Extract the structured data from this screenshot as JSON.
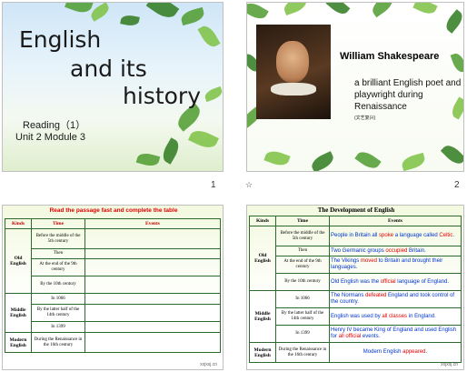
{
  "slides": [
    {
      "number": "1",
      "title_lines": [
        "English",
        "and its",
        "history"
      ],
      "reading": "Reading（1）",
      "unit": "Unit 2 Module 3"
    },
    {
      "number": "2",
      "name": "William Shakespeare",
      "description": "a brilliant English poet and playwright during Renaissance",
      "note": "(文艺复兴)"
    },
    {
      "number": "",
      "heading": "Read the passage fast and complete the table"
    },
    {
      "number": "",
      "heading": "The Development of English"
    }
  ],
  "table": {
    "headers": [
      "Kinds",
      "Time",
      "Events"
    ],
    "kinds": [
      "Old English",
      "Middle English",
      "Modern English"
    ],
    "times": [
      "Before the middle of the 5th century",
      "Then",
      "At the end of the 9th century",
      "By the 10th century",
      "In 1066",
      "By the latter half of the 14th century",
      "In 1399",
      "During the Renaissance in the 16th century"
    ]
  },
  "events": [
    [
      "People in Britain all ",
      "spoke",
      " a language called ",
      "Celtic",
      "."
    ],
    [
      "Two Germanic groups ",
      "occupied",
      " Britain."
    ],
    [
      "The Vikings ",
      "moved",
      " to Britain and brought their languages."
    ],
    [
      "Old English was the ",
      "official",
      " language of England."
    ],
    [
      "The Normans ",
      "defeated",
      " England and took control of the country."
    ],
    [
      "English was used by ",
      "all classes",
      " in England."
    ],
    [
      "Henry IV became King of England and used English for ",
      "all official",
      " events."
    ],
    [
      "Modern English ",
      "appeared",
      "."
    ]
  ],
  "watermark": "xxjxsj.cn",
  "colors": {
    "accent_red": "#e00000",
    "event_blue": "#0033cc",
    "border_green": "#2d6a2d"
  }
}
